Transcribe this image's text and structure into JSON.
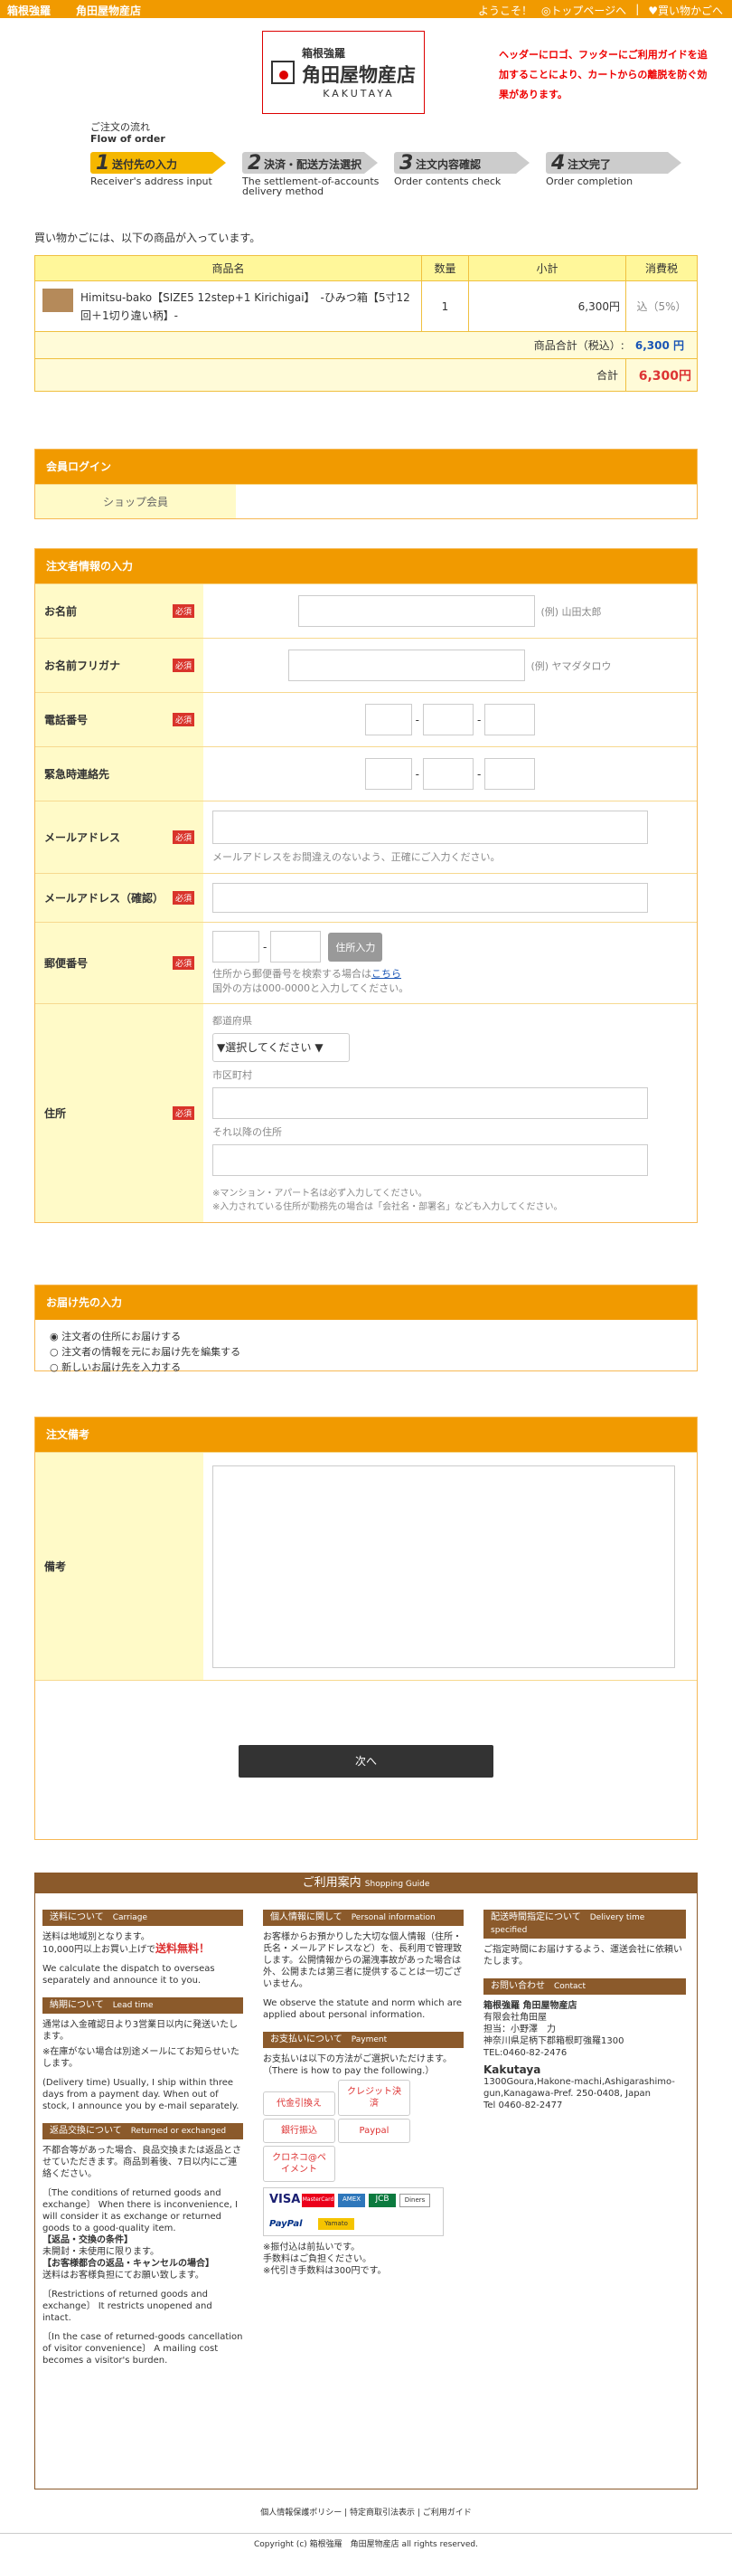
{
  "topbar": {
    "brand1": "箱根強羅",
    "brand2": "角田屋物産店",
    "welcome": "ようこそ！",
    "top": "◎トップページへ",
    "sep": "|",
    "cart": "♥買い物かごへ"
  },
  "logo": {
    "line1": "箱根強羅",
    "line2": "角田屋物産店",
    "line3": "KAKUTAYA"
  },
  "note": "ヘッダーにロゴ、フッターにご利用ガイドを追加することにより、カートからの離脱を防ぐ効果があります。",
  "flow": {
    "title": "ご注文の流れ",
    "title_en": "Flow of order",
    "steps": [
      {
        "num": "1",
        "label": "送付先の入力",
        "sub": "Receiver's address input"
      },
      {
        "num": "2",
        "label": "決済・配送方法選択",
        "sub": "The settlement-of-accounts delivery method"
      },
      {
        "num": "3",
        "label": "注文内容確認",
        "sub": "Order contents check"
      },
      {
        "num": "4",
        "label": "注文完了",
        "sub": "Order completion"
      }
    ]
  },
  "intro": "買い物かごには、以下の商品が入っています。",
  "cart": {
    "headers": [
      "商品名",
      "数量",
      "小計",
      "消費税"
    ],
    "item": {
      "name": "Himitsu-bako【SIZE5 12step+1 Kirichigai】　-ひみつ箱【5寸12回＋1切り違い柄】-",
      "qty": "1",
      "subtotal": "6,300円",
      "tax": "込（5%）"
    },
    "subtotal_label": "商品合計（税込）:",
    "subtotal_value": "6,300 円",
    "total_label": "合計",
    "total_value": "6,300円"
  },
  "login": {
    "title": "会員ログイン",
    "shop_member": "ショップ会員"
  },
  "orderer": {
    "title": "注文者情報の入力",
    "required": "必須",
    "name_label": "お名前",
    "name_ex": "(例) 山田太郎",
    "kana_label": "お名前フリガナ",
    "kana_ex": "(例) ヤマダタロウ",
    "tel_label": "電話番号",
    "emg_label": "緊急時連絡先",
    "dash": "-",
    "mail_label": "メールアドレス",
    "mail_hint": "メールアドレスをお間違えのないよう、正確にご入力ください。",
    "mail2_label": "メールアドレス（確認）",
    "zip_label": "郵便番号",
    "zip_btn": "住所入力",
    "zip_hint1": "住所から郵便番号を検索する場合は",
    "zip_link": "こちら",
    "zip_hint2": "国外の方は000-0000と入力してください。",
    "addr_label": "住所",
    "pref_label": "都道府県",
    "pref_select": "▼選択してください ▼",
    "city_label": "市区町村",
    "other_label": "それ以降の住所",
    "addr_note1": "※マンション・アパート名は必ず入力してください。",
    "addr_note2": "※入力されている住所が勤務先の場合は「会社名・部署名」なども入力してください。"
  },
  "delivery": {
    "title": "お届け先の入力",
    "opts": [
      "注文者の住所にお届けする",
      "注文者の情報を元にお届け先を編集する",
      "新しいお届け先を入力する"
    ]
  },
  "remarks": {
    "title": "注文備考",
    "label": "備考"
  },
  "next_btn": "次へ",
  "guide": {
    "title": "ご利用案内",
    "title_en": "Shopping Guide",
    "carriage_title": "送料について",
    "carriage_en": "Carriage",
    "carriage_t1": "送料は地域別となります。",
    "carriage_t2": "10,000円以上お買い上げで",
    "carriage_free": "送料無料！",
    "carriage_t3": "We calculate the dispatch to overseas separately and announce it to you.",
    "lead_title": "納期について",
    "lead_en": "Lead time",
    "lead_t1": "通常は入金確認日より3営業日以内に発送いたします。",
    "lead_t2": "※在庫がない場合は別途メールにてお知らせいたします。",
    "lead_t3": "(Delivery time) Usually, I ship within three days from a payment day. When out of stock, I announce you by e-mail separately.",
    "ret_title": "返品交換について",
    "ret_en": "Returned or exchanged",
    "ret_t1": "不都合等があった場合、良品交換または返品とさせていただきます。商品到着後、7日以内にご連絡ください。",
    "ret_t2": "〔The conditions of returned goods and exchange〕 When there is inconvenience, I will consider it as exchange or returned goods to a good-quality item.",
    "ret_t3": "【返品・交換の条件】",
    "ret_t4": "未開封・未使用に限ります。",
    "ret_t5": "【お客様都合の返品・キャンセルの場合】",
    "ret_t6": "送料はお客様負担にてお願い致します。",
    "ret_t7": "〔Restrictions of returned goods and exchange〕 It restricts unopened and intact.",
    "ret_t8": "〔In the case of returned-goods cancellation of visitor convenience〕 A mailing cost becomes a visitor's burden.",
    "pi_title": "個人情報に関して",
    "pi_en": "Personal information",
    "pi_t1": "お客様からお預かりした大切な個人情報（住所・氏名・メールアドレスなど）を、長利用で管理致します。公開情報からの漏洩事故があった場合は外、公開または第三者に提供することは一切ございません。",
    "pi_t2": "We observe the statute and norm which are applied about personal information.",
    "pay_title": "お支払いについて",
    "pay_en": "Payment",
    "pay_t1": "お支払いは以下の方法がご選択いただけます。（There is how to pay the following.）",
    "pay_opts": [
      "代金引換え",
      "クレジット決済",
      "銀行振込",
      "Paypal",
      "クロネコ@ペイメント"
    ],
    "cards": [
      "VISA",
      "MasterCard",
      "AMEX",
      "JCB",
      "Diners",
      "PayPal",
      "Yamato"
    ],
    "pay_n1": "※振付込は前払いです。",
    "pay_n2": "手数料はご負担ください。",
    "pay_n3": "※代引き手数料は300円です。",
    "dt_title": "配送時間指定について",
    "dt_en": "Delivery time specified",
    "dt_t1": "ご指定時間にお届けするよう、運送会社に依頼いたします。",
    "contact_title": "お問い合わせ",
    "contact_en": "Contact",
    "contact_t1": "箱根強羅 角田屋物産店",
    "contact_t2": "有限会社角田屋",
    "contact_t3": "担当：小野澤　力",
    "contact_t4": "神奈川県足柄下郡箱根町強羅1300",
    "contact_t5": "TEL:0460-82-2476",
    "contact_t6": "Kakutaya",
    "contact_t7": "1300Goura,Hakone-machi,Ashigarashimo-gun,Kanagawa-Pref. 250-0408, Japan",
    "contact_t8": "Tel 0460-82-2477"
  },
  "links": [
    "個人情報保護ポリシー",
    "特定商取引法表示",
    "ご利用ガイド"
  ],
  "copyright": "Copyright (c) 箱根強羅　角田屋物産店 all rights reserved."
}
